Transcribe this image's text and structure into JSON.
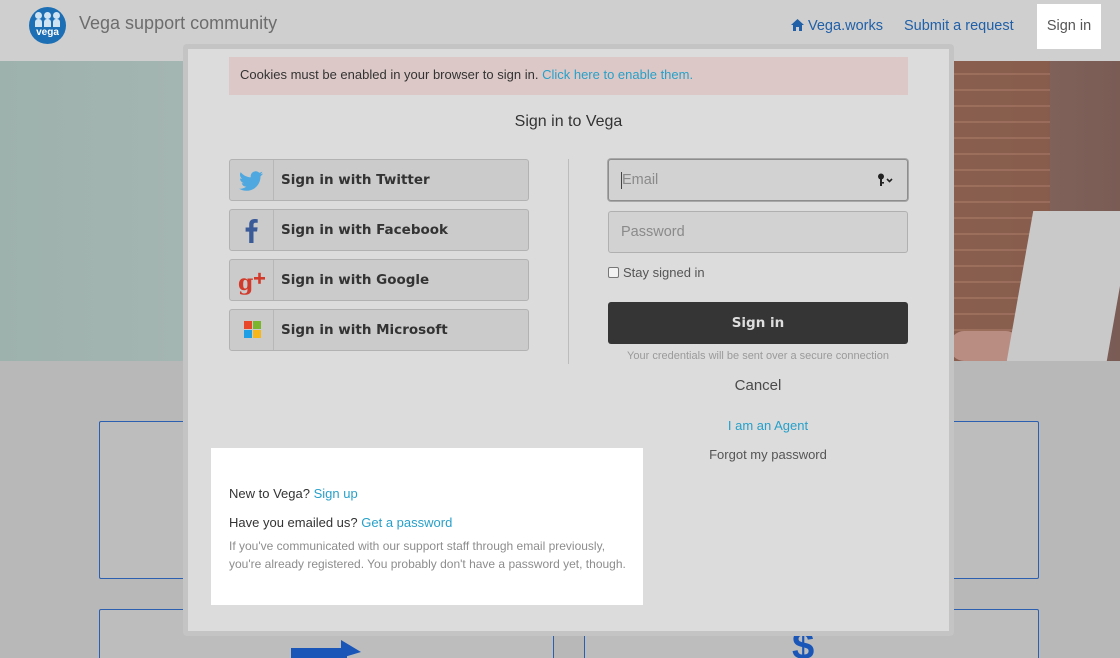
{
  "header": {
    "site_name": "Vega support community",
    "logo_text": "vega",
    "nav": {
      "home_label": "Vega.works",
      "submit_label": "Submit a request",
      "signin_label": "Sign in"
    }
  },
  "modal": {
    "cookie_alert": {
      "text": "Cookies must be enabled in your browser to sign in.",
      "link": "Click here to enable them."
    },
    "title": "Sign in to Vega",
    "social": [
      {
        "label": "Sign in with Twitter",
        "icon": "twitter-icon"
      },
      {
        "label": "Sign in with Facebook",
        "icon": "facebook-icon"
      },
      {
        "label": "Sign in with Google",
        "icon": "google-plus-icon"
      },
      {
        "label": "Sign in with Microsoft",
        "icon": "microsoft-icon"
      }
    ],
    "form": {
      "email_placeholder": "Email",
      "password_placeholder": "Password",
      "stay_signed_in": "Stay signed in",
      "submit_label": "Sign in",
      "secure_note": "Your credentials will be sent over a secure connection",
      "cancel_label": "Cancel",
      "agent_link": "I am an Agent",
      "forgot_link": "Forgot my password"
    },
    "help": {
      "new_prompt": "New to Vega?",
      "signup_link": "Sign up",
      "emailed_prompt": "Have you emailed us?",
      "get_password_link": "Get a password",
      "note": "If you've communicated with our support staff through email previously, you're already registered. You probably don't have a password yet, though."
    }
  },
  "colors": {
    "brand": "#1d6fb5",
    "link": "#27a0c9",
    "nav_link": "#2060a8",
    "primary_button": "#353535",
    "alert_bg": "#dcc9c7",
    "twitter": "#4fa8e0",
    "facebook": "#3b5a98",
    "google": "#d23b2b"
  }
}
